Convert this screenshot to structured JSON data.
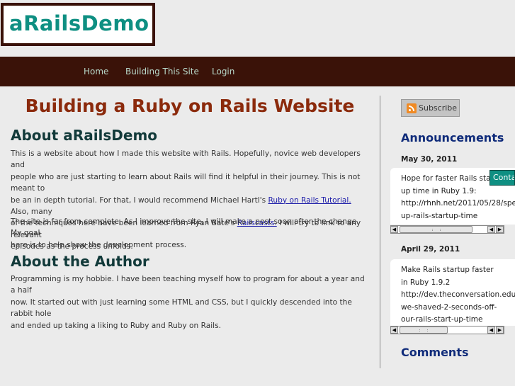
{
  "site": {
    "logo": "aRailsDemo"
  },
  "nav": {
    "items": [
      "Home",
      "Building This Site",
      "Login"
    ]
  },
  "main": {
    "title": "Building a Ruby on Rails Website",
    "about_demo": {
      "heading": "About aRailsDemo",
      "p1": {
        "line1": "This is a website about how I made this website with Rails. Hopefully, novice web developers and",
        "line2": "people who are just starting to learn about Rails will find it helpful in their journey. This is not meant to",
        "line3": "be an in depth tutorial. For that, I would recommend Michael Hartl's ",
        "link1": "Ruby on Rails Tutorial.",
        "line3_after": " Also, many",
        "line4": "of the techniques here have been learned from Ryan Bate's ",
        "link2": "Railscasts.",
        "line4_after": " I will try to link to any relevant",
        "line5": "episodes as the process unfolds."
      },
      "p2": {
        "line1": "The site is far from complete. As I improve the site, I will make a post soon after the change. My goal",
        "line2": "here is to help show the development process."
      }
    },
    "about_author": {
      "heading": "About the Author",
      "p1": {
        "line1": "Programming is my hobbie. I have been teaching myself how to program for about a year and a half",
        "line2": "now. It started out with just learning some HTML and CSS, but I quickly descended into the rabbit hole",
        "line3": "and ended up taking a liking to Ruby and Ruby on Rails."
      }
    }
  },
  "sidebar": {
    "subscribe_label": "Subscribe",
    "announcements_heading": "Announcements",
    "announcements": [
      {
        "date": "May 30, 2011",
        "lines": [
          "Hope for faster Rails start",
          "up time in Ruby 1.9:",
          "http://rhnh.net/2011/05/28/spe",
          "up-rails-startup-time"
        ]
      },
      {
        "date": "April 29, 2011",
        "lines": [
          "Make Rails startup faster",
          "in Ruby 1.9.2",
          "http://dev.theconversation.edu",
          "we-shaved-2-seconds-off-",
          "our-rails-start-up-time"
        ]
      }
    ],
    "comments_heading": "Comments"
  },
  "contact_tab": {
    "label": "Contact"
  },
  "icons": {
    "rss": "rss-icon",
    "scroll_left": "arrow-left-icon",
    "scroll_right": "arrow-right-icon"
  },
  "colors": {
    "navbar": "#3a1208",
    "logo": "#0e8f82",
    "title": "#8b2a0c",
    "link": "#1a1aa8"
  }
}
